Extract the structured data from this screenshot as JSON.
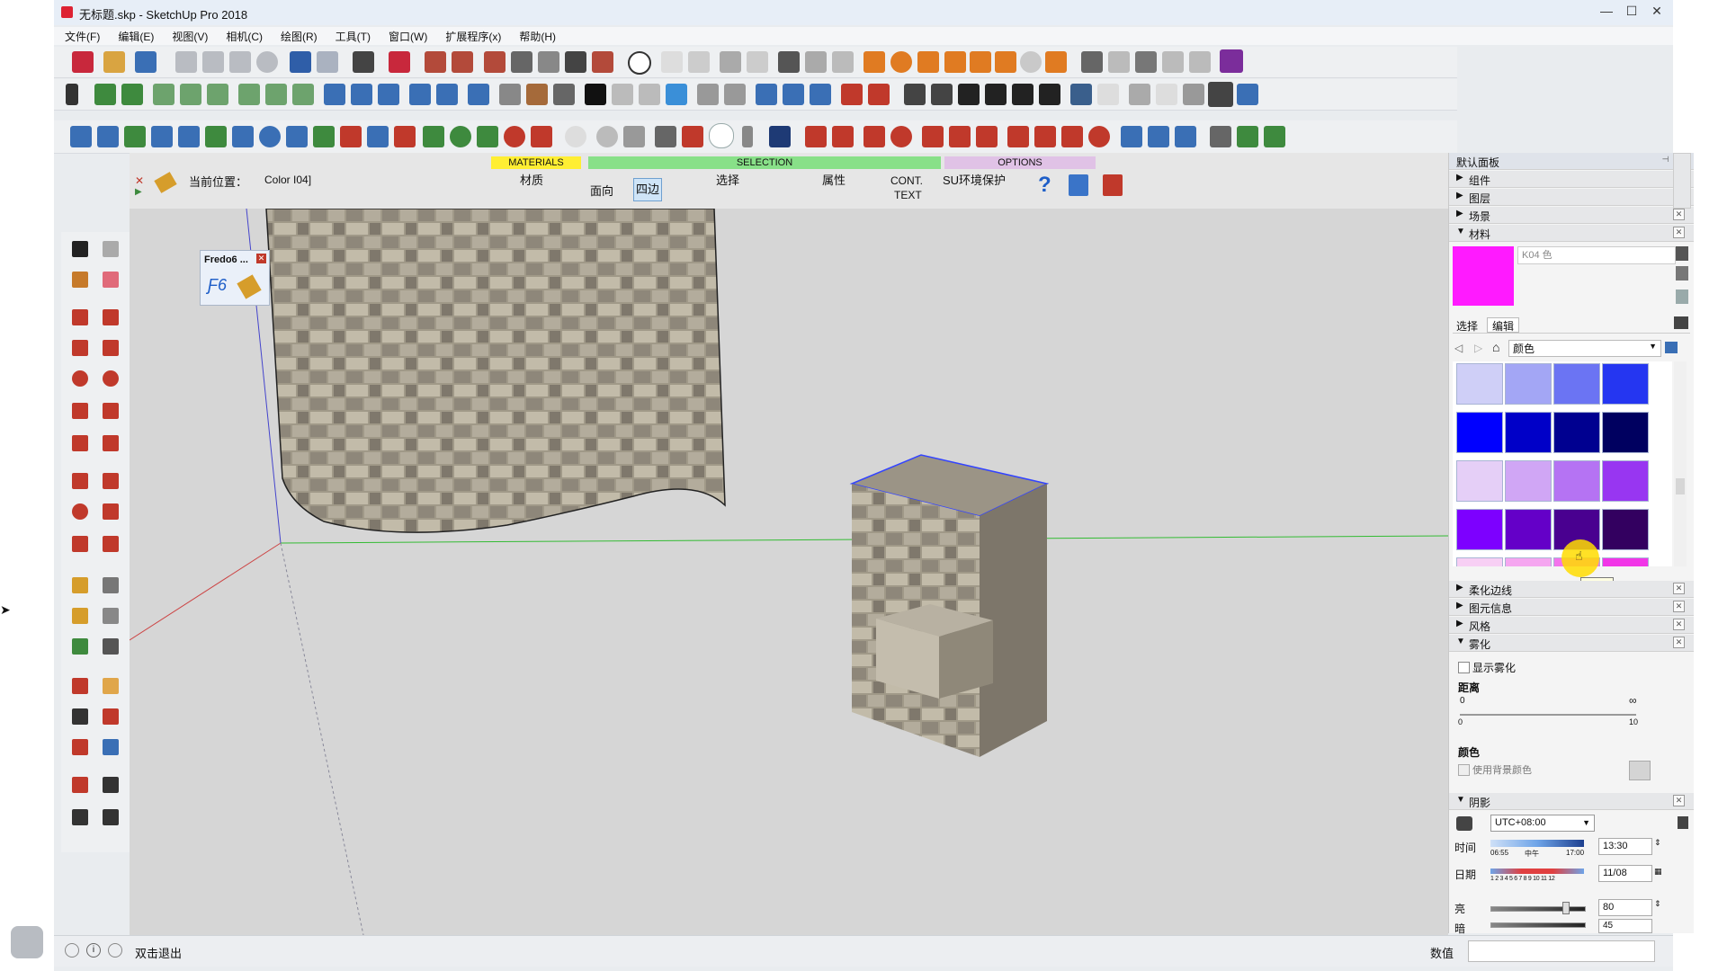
{
  "window": {
    "title": "无标题.skp - SketchUp Pro 2018",
    "min": "—",
    "max": "☐",
    "close": "✕"
  },
  "menu": [
    "文件(F)",
    "编辑(E)",
    "视图(V)",
    "相机(C)",
    "绘图(R)",
    "工具(T)",
    "窗口(W)",
    "扩展程序(x)",
    "帮助(H)"
  ],
  "plugin": {
    "current_label": "当前位置：",
    "current_value": "Color I04]",
    "materials": "MATERIALS",
    "selection": "SELECTION",
    "options": "OPTIONS",
    "material": "材质",
    "face": "面向",
    "edges": "四边",
    "select": "选择",
    "attr": "属性",
    "cont": "CONT.",
    "text": "TEXT",
    "env": "SU环境保护",
    "help": "?"
  },
  "fredo": {
    "title": "Fredo6 ...",
    "logo": "Ƒ6"
  },
  "tray": {
    "title": "默认面板",
    "sections_top": [
      "组件",
      "图层",
      "场景"
    ],
    "materials": "材料",
    "material_name": "K04 色",
    "tab_select": "选择",
    "tab_edit": "编辑",
    "library": "颜色",
    "tooltip": "K04 色",
    "sections_mid": [
      "柔化边线",
      "图元信息",
      "风格"
    ],
    "fog": "雾化",
    "fog_show": "显示雾化",
    "distance": "距离",
    "dist_start": "0",
    "dist_inf": "∞",
    "dist_min": "0",
    "dist_max": "10",
    "color": "颜色",
    "use_bg": "使用背景颜色",
    "shadow": "阴影",
    "tz": "UTC+08:00",
    "time": "时间",
    "time_start": "06:55",
    "time_mid": "中午",
    "time_end": "17:00",
    "time_val": "13:30",
    "date": "日期",
    "date_months": "1 2 3 4 5 6 7 8 9 10 11 12",
    "date_val": "11/08",
    "light": "亮",
    "light_val": "80",
    "dark": "暗",
    "dark_val": "45",
    "light_level": 0.8,
    "colors": {
      "selected": "#ff1aff",
      "swatches": [
        [
          "#cfcff7",
          "#a3a6f5",
          "#6b74f3",
          "#2536f1"
        ],
        [
          "#0000ff",
          "#0000c8",
          "#000090",
          "#000060"
        ],
        [
          "#e5cff7",
          "#d0a6f5",
          "#b573f3",
          "#9836f1"
        ],
        [
          "#7d00ff",
          "#6400c8",
          "#490090",
          "#330060"
        ],
        [
          "#f7cff4",
          "#f5a6f0",
          "#f373ec",
          "#f136e7"
        ]
      ]
    }
  },
  "status": {
    "hint": "双击退出",
    "measure_label": "数值",
    "measure_value": ""
  }
}
